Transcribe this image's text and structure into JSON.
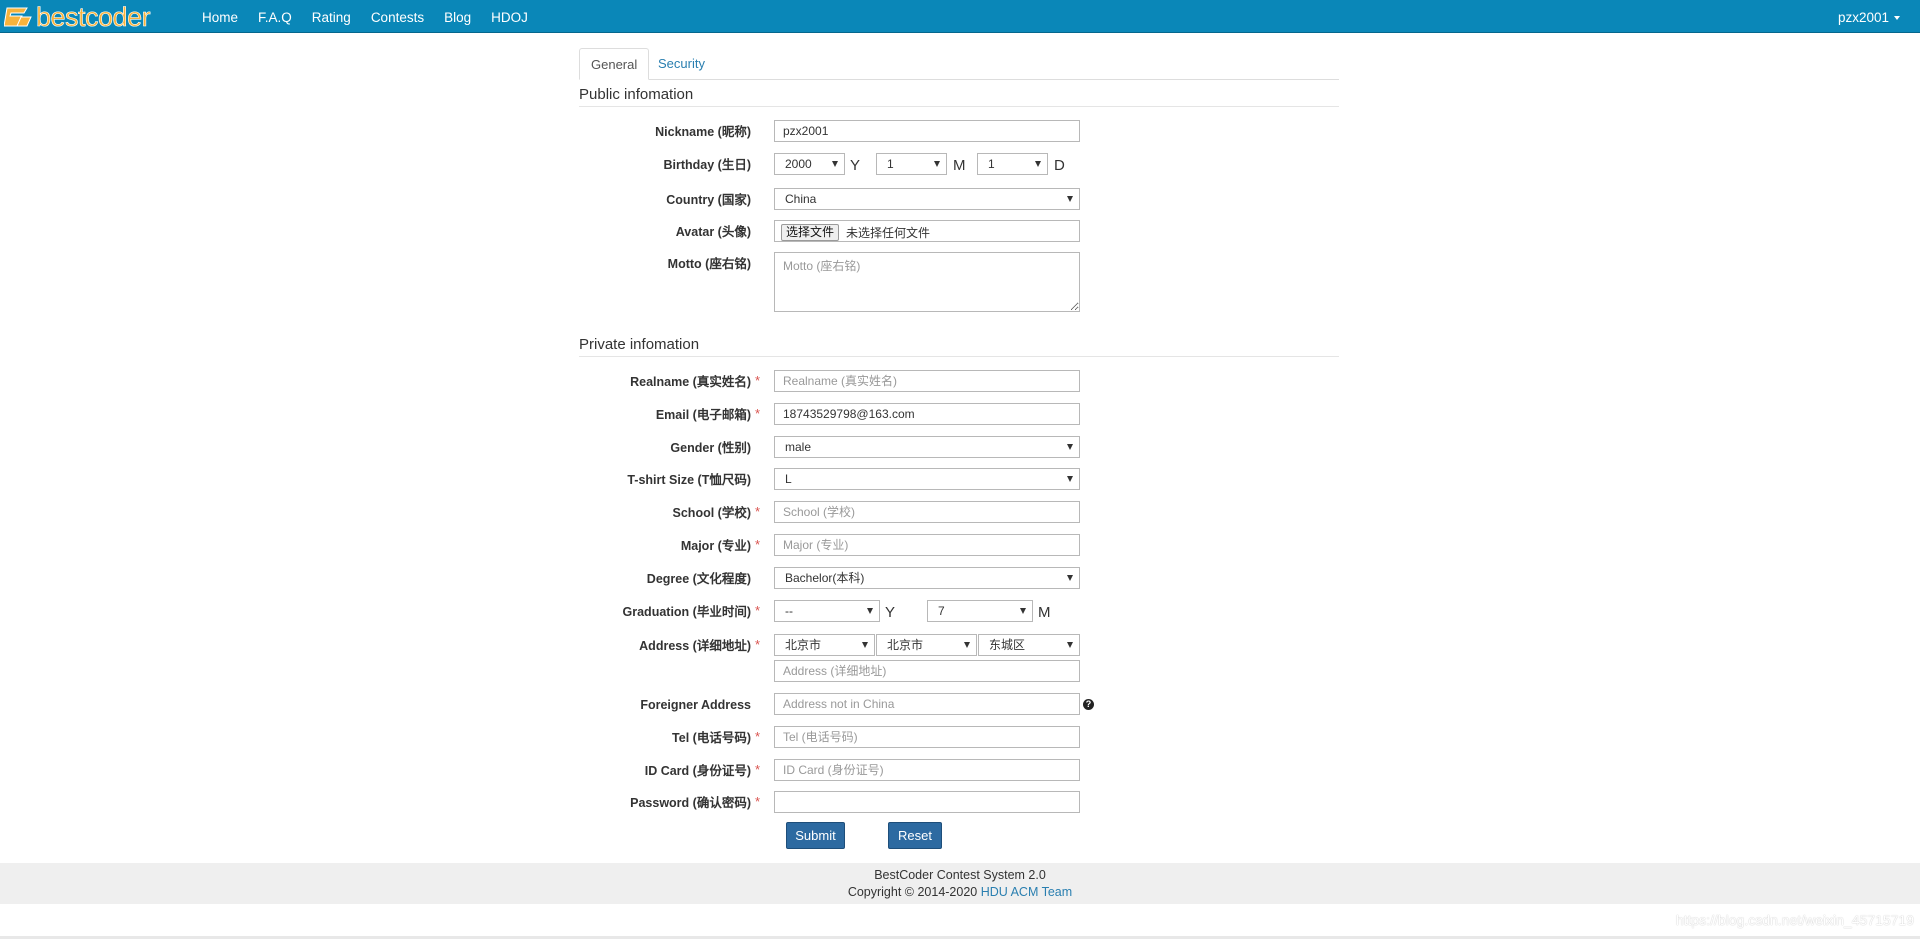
{
  "nav": {
    "brand": "bestcoder",
    "links": [
      "Home",
      "F.A.Q",
      "Rating",
      "Contests",
      "Blog",
      "HDOJ"
    ],
    "user": "pzx2001"
  },
  "tabs": [
    "General",
    "Security"
  ],
  "sections": {
    "public": "Public infomation",
    "private": "Private infomation"
  },
  "fields": {
    "nickname": {
      "label": "Nickname",
      "cn": "(昵称)",
      "value": "pzx2001"
    },
    "birthday": {
      "label": "Birthday",
      "cn": "(生日)",
      "year": "2000",
      "month": "1",
      "day": "1",
      "y": "Y",
      "m": "M",
      "d": "D"
    },
    "country": {
      "label": "Country",
      "cn": "(国家)",
      "value": "China"
    },
    "avatar": {
      "label": "Avatar",
      "cn": "(头像)",
      "button": "选择文件",
      "status": "未选择任何文件"
    },
    "motto": {
      "label": "Motto",
      "cn": "(座右铭)",
      "placeholder": "Motto (座右铭)"
    },
    "realname": {
      "label": "Realname",
      "cn": "(真实姓名)",
      "placeholder": "Realname (真实姓名)"
    },
    "email": {
      "label": "Email",
      "cn": "(电子邮箱)",
      "value": "18743529798@163.com"
    },
    "gender": {
      "label": "Gender",
      "cn": "(性别)",
      "value": "male"
    },
    "tshirt": {
      "label": "T-shirt Size",
      "cn": "(T恤尺码)",
      "value": "L"
    },
    "school": {
      "label": "School",
      "cn": "(学校)",
      "placeholder": "School (学校)"
    },
    "major": {
      "label": "Major",
      "cn": "(专业)",
      "placeholder": "Major (专业)"
    },
    "degree": {
      "label": "Degree",
      "cn": "(文化程度)",
      "value": "Bachelor(本科)"
    },
    "graduation": {
      "label": "Graduation",
      "cn": "(毕业时间)",
      "year": "--",
      "month": "7",
      "y": "Y",
      "m": "M"
    },
    "address": {
      "label": "Address",
      "cn": "(详细地址)",
      "province": "北京市",
      "city": "北京市",
      "district": "东城区",
      "placeholder": "Address (详细地址)"
    },
    "foreigner": {
      "label": "Foreigner Address",
      "placeholder": "Address not in China",
      "help": "?"
    },
    "tel": {
      "label": "Tel",
      "cn": "(电话号码)",
      "placeholder": "Tel (电话号码)"
    },
    "idcard": {
      "label": "ID Card",
      "cn": "(身份证号)",
      "placeholder": "ID Card (身份证号)"
    },
    "password": {
      "label": "Password",
      "cn": "(确认密码)"
    }
  },
  "required_mark": "*",
  "buttons": {
    "submit": "Submit",
    "reset": "Reset"
  },
  "footer": {
    "line1": "BestCoder Contest System 2.0",
    "line2_prefix": "Copyright © 2014-2020 ",
    "line2_link": "HDU ACM Team"
  },
  "watermark": "https://blog.csdn.net/weixin_45715719",
  "colors": {
    "navbar": "#0a87b8",
    "brand": "#f7b33c",
    "button": "#2d6aa1",
    "link": "#2a7fb0",
    "required": "#d9534f"
  }
}
